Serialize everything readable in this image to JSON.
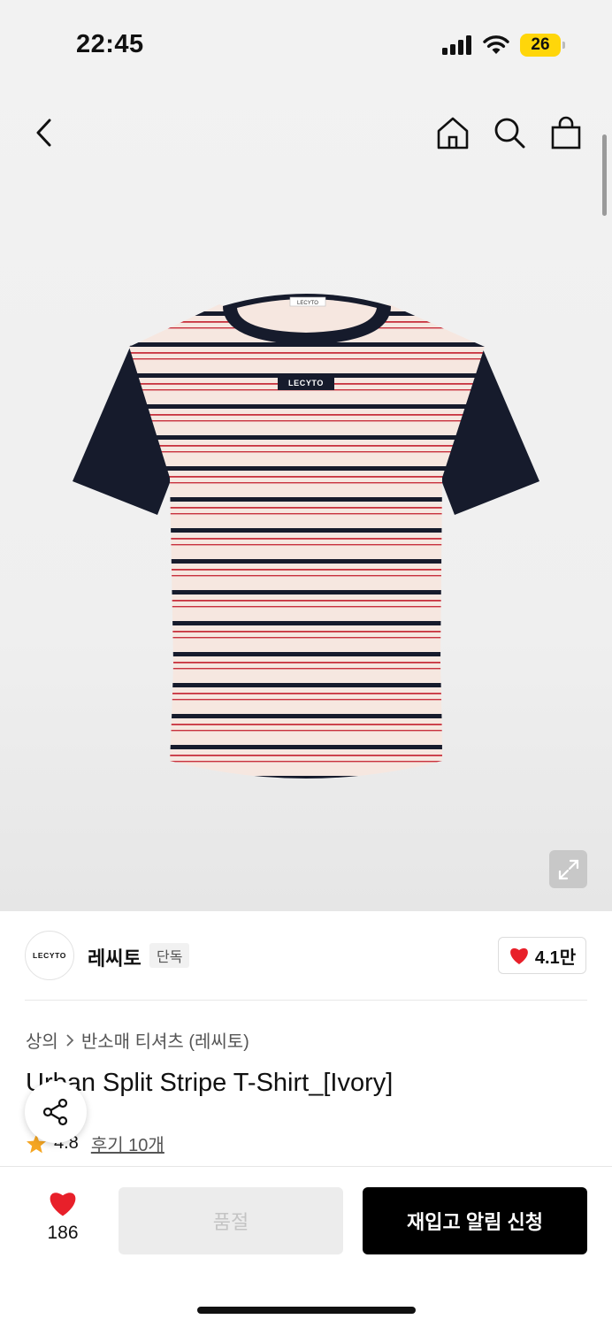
{
  "status_bar": {
    "time": "22:45",
    "battery_level": "26",
    "icons": [
      "cellular-signal-icon",
      "wifi-icon",
      "battery-icon"
    ]
  },
  "nav": {
    "icons": [
      "back-chevron-icon",
      "home-icon",
      "search-icon",
      "shopping-bag-icon"
    ]
  },
  "product_image": {
    "garment_label": "LECYTO",
    "neck_label": "LECYTO",
    "colors": {
      "ivory": "#f6e7e0",
      "navy": "#161b2c",
      "red_stripe": "#c8323e"
    }
  },
  "brand": {
    "logo_text": "LECYTO",
    "name": "레씨토",
    "exclusive_badge": "단독",
    "likes": "4.1만"
  },
  "breadcrumb": {
    "category": "상의",
    "subcategory": "반소매 티셔츠 (레씨토)"
  },
  "product": {
    "title": "Urban Split Stripe T-Shirt_[Ivory]",
    "rating": "4.8",
    "reviews": "후기 10개"
  },
  "bottom_bar": {
    "wish_count": "186",
    "soldout_label": "품절",
    "restock_label": "재입고 알림 신청"
  },
  "accent_colors": {
    "heart": "#e8202a",
    "star": "#f5a623",
    "battery": "#ffd60a",
    "primary_button": "#000000"
  }
}
